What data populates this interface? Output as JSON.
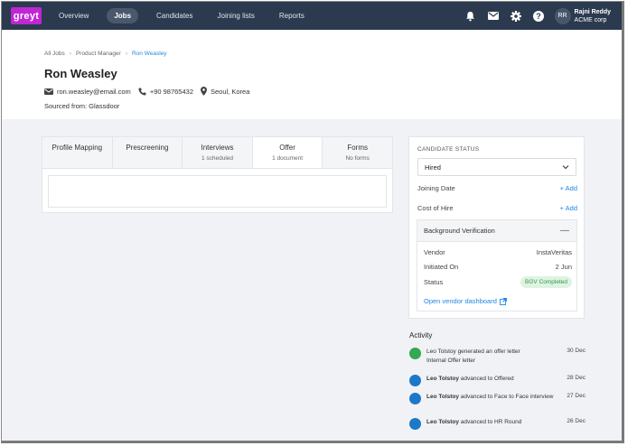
{
  "app": {
    "logo": "greyt",
    "nav": [
      "Overview",
      "Jobs",
      "Candidates",
      "Joining lists",
      "Reports"
    ],
    "active_nav": "Jobs",
    "user": {
      "initials": "RR",
      "name": "Rajni Reddy",
      "company": "ACME corp"
    },
    "icons": [
      "bell-icon",
      "mail-icon",
      "gear-icon",
      "help-icon"
    ]
  },
  "breadcrumb": [
    "All Jobs",
    "Product Manager",
    "Ron Weasley"
  ],
  "candidate": {
    "name": "Ron Weasley",
    "email": "ron.weasley@email.com",
    "phone": "+90 98765432",
    "location": "Seoul, Korea",
    "source": "Sourced from: Glassdoor"
  },
  "tabs": [
    {
      "label": "Profile Mapping",
      "sub": ""
    },
    {
      "label": "Prescreening",
      "sub": ""
    },
    {
      "label": "Interviews",
      "sub": "1 scheduled"
    },
    {
      "label": "Offer",
      "sub": "1 document"
    },
    {
      "label": "Forms",
      "sub": "No forms"
    }
  ],
  "active_tab": "Offer",
  "status_panel": {
    "title": "CANDIDATE STATUS",
    "status": "Hired",
    "joining_date_label": "Joining Date",
    "cost_label": "Cost of Hire",
    "add_label": "+ Add",
    "bgv": {
      "title": "Background Verification",
      "collapse": "—",
      "vendor_label": "Vendor",
      "vendor_value": "InstaVeritas",
      "initiated_label": "Initiated On",
      "initiated_value": "2 Jun",
      "status_label": "Status",
      "status_value": "BGV Completed",
      "link": "Open vendor dashboard"
    }
  },
  "activity": {
    "title": "Activity",
    "items": [
      {
        "actor": "Leo Tolstoy",
        "action": " generated an offer letter",
        "detail": "Internal Offer letter",
        "date": "30 Dec",
        "color": "#34a853"
      },
      {
        "actor": "Leo Tolstoy",
        "action": " advanced to Offered",
        "detail": "",
        "date": "28 Dec",
        "color": "#1e78c8"
      },
      {
        "actor": "Leo Tolstoy",
        "action": " advanced to Face to Face interview",
        "detail": "",
        "date": "27 Dec",
        "color": "#1e78c8"
      },
      {
        "actor": "Leo Tolstoy",
        "action": " advanced to HR Round",
        "detail": "",
        "date": "26 Dec",
        "color": "#1e78c8"
      }
    ]
  },
  "colors": {
    "topbar": "#2b3a4e",
    "brand": "#c026d3",
    "accent": "#1e88e5",
    "success": "#2e9b4a"
  }
}
